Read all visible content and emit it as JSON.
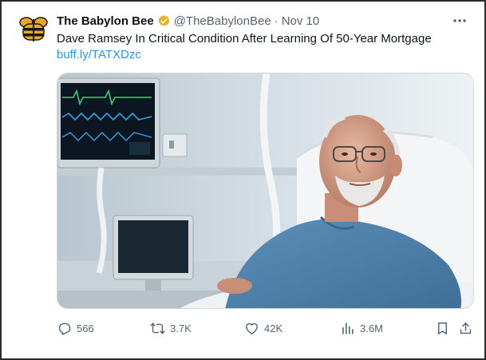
{
  "tweet": {
    "display_name": "The Babylon Bee",
    "handle": "@TheBabylonBee",
    "separator": "·",
    "time": "Nov 10",
    "text": "Dave Ramsey In Critical Condition After Learning Of 50-Year Mortgage",
    "link": "buff.ly/TATXDzc"
  },
  "actions": {
    "replies": "566",
    "reposts": "3.7K",
    "likes": "42K",
    "views": "3.6M"
  },
  "icons": {
    "avatar": "babylon-bee-logo",
    "verified": "verified-badge-icon",
    "more": "more-icon",
    "reply": "reply-icon",
    "repost": "repost-icon",
    "like": "heart-icon",
    "views": "views-icon",
    "bookmark": "bookmark-icon",
    "share": "share-icon"
  },
  "colors": {
    "text": "#0f1419",
    "secondary": "#536471",
    "link": "#1d9bf0",
    "verified": "#e6b422"
  }
}
